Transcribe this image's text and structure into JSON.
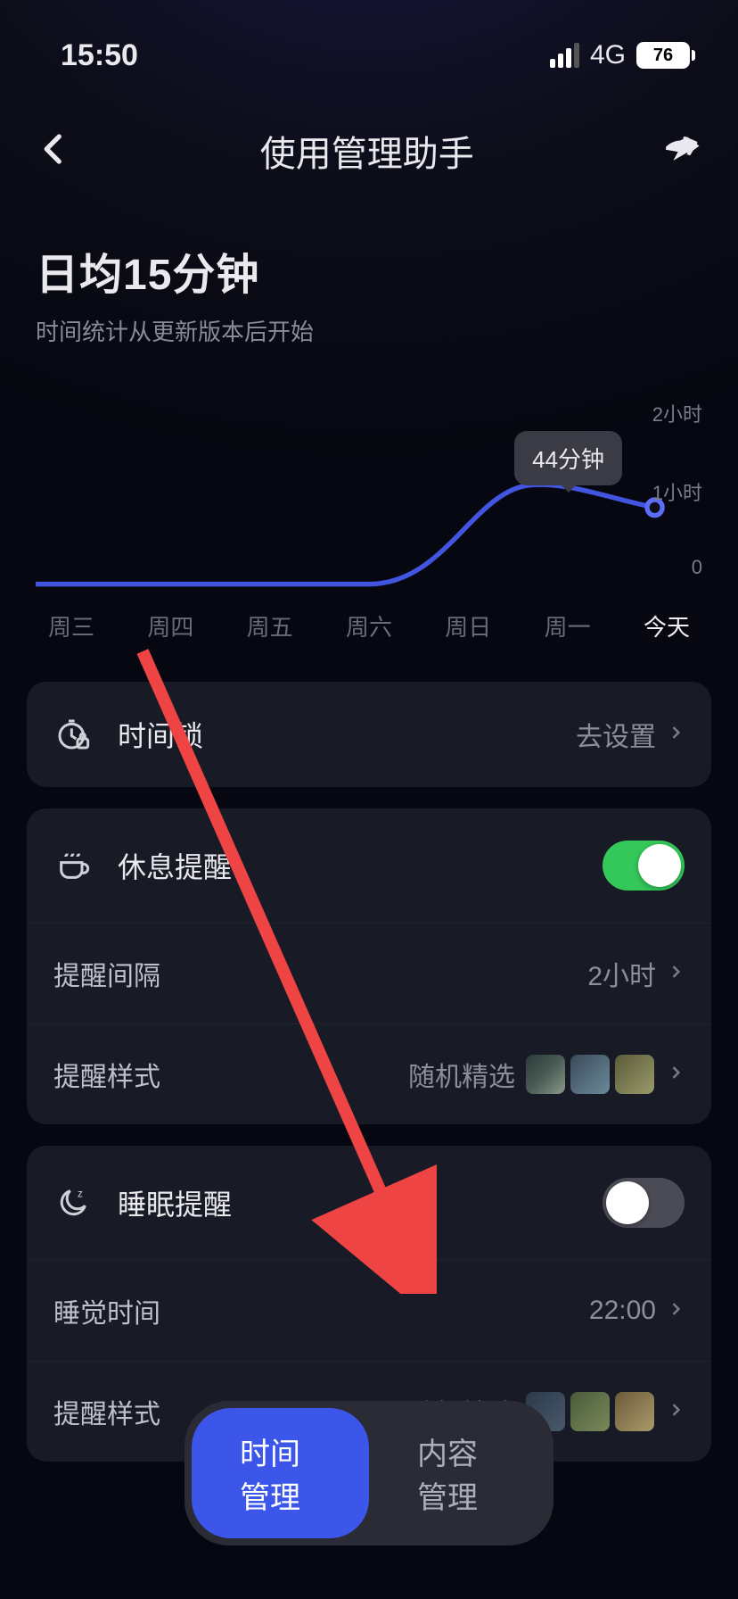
{
  "status": {
    "time": "15:50",
    "network": "4G",
    "battery": "76"
  },
  "header": {
    "title": "使用管理助手"
  },
  "summary": {
    "heading": "日均15分钟",
    "note": "时间统计从更新版本后开始"
  },
  "chart_data": {
    "type": "line",
    "categories": [
      "周三",
      "周四",
      "周五",
      "周六",
      "周日",
      "周一",
      "今天"
    ],
    "values": [
      0,
      0,
      0,
      0,
      0,
      58,
      44
    ],
    "tooltip_index": 6,
    "tooltip_label": "44分钟",
    "ylabel": "",
    "ylim": [
      0,
      120
    ],
    "yticks": [
      {
        "v": 120,
        "label": "2小时"
      },
      {
        "v": 60,
        "label": "1小时"
      },
      {
        "v": 0,
        "label": "0"
      }
    ]
  },
  "cards": {
    "time_lock": {
      "title": "时间锁",
      "action": "去设置"
    },
    "rest": {
      "title": "休息提醒",
      "enabled": true,
      "interval": {
        "label": "提醒间隔",
        "value": "2小时"
      },
      "style": {
        "label": "提醒样式",
        "value": "随机精选"
      }
    },
    "sleep": {
      "title": "睡眠提醒",
      "enabled": false,
      "time": {
        "label": "睡觉时间",
        "value": "22:00"
      },
      "style": {
        "label": "提醒样式",
        "value": "随机精选"
      }
    }
  },
  "tabs": {
    "a": "时间管理",
    "b": "内容管理",
    "active": "a"
  }
}
